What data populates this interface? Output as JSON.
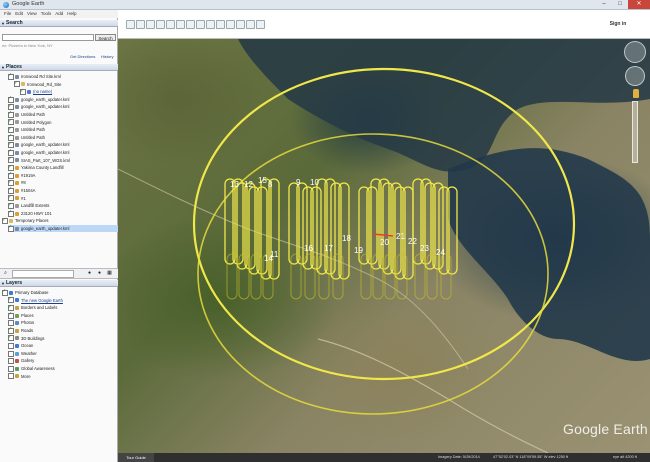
{
  "window": {
    "title": "Google Earth",
    "min": "–",
    "max": "□",
    "close": "✕"
  },
  "menu": [
    "File",
    "Edit",
    "View",
    "Tools",
    "Add",
    "Help"
  ],
  "toolbar": {
    "sign_in": "Sign in"
  },
  "search": {
    "header": "Search",
    "placeholder": "",
    "button": "Search",
    "hint": "ex: Pizzeria in New York, NY",
    "get_directions": "Get Directions",
    "history": "History"
  },
  "places": {
    "header": "Places",
    "items": [
      {
        "label": "Ironwood Rd Site.kml",
        "indent": 1,
        "checked": true,
        "icon": "kml-icon",
        "color": "#7a8aa0"
      },
      {
        "label": "Ironwood_Rd_Site",
        "indent": 2,
        "checked": true,
        "icon": "folder-icon",
        "color": "#d8b860"
      },
      {
        "label": "(no name)",
        "indent": 3,
        "checked": true,
        "icon": "path-icon",
        "color": "#5577cc",
        "link": true
      },
      {
        "label": "google_earth_updater.kml",
        "indent": 1,
        "checked": true,
        "icon": "kml-icon",
        "color": "#7a8aa0"
      },
      {
        "label": "google_earth_updater.kml",
        "indent": 1,
        "checked": true,
        "icon": "kml-icon",
        "color": "#7a8aa0"
      },
      {
        "label": "Untitled Path",
        "indent": 1,
        "checked": true,
        "icon": "path-icon",
        "color": "#9a9a9a"
      },
      {
        "label": "Untitled Polygon",
        "indent": 1,
        "checked": true,
        "icon": "polygon-icon",
        "color": "#9a9a9a"
      },
      {
        "label": "Untitled Path",
        "indent": 1,
        "checked": true,
        "icon": "path-icon",
        "color": "#9a9a9a"
      },
      {
        "label": "Untitled Path",
        "indent": 1,
        "checked": true,
        "icon": "path-icon",
        "color": "#9a9a9a"
      },
      {
        "label": "google_earth_updater.kml",
        "indent": 1,
        "checked": true,
        "icon": "kml-icon",
        "color": "#7a8aa0"
      },
      {
        "label": "google_earth_updater.kml",
        "indent": 1,
        "checked": true,
        "icon": "kml-icon",
        "color": "#7a8aa0"
      },
      {
        "label": "SIAS_Part_107_WGS.kml",
        "indent": 1,
        "checked": true,
        "icon": "kml-icon",
        "color": "#7a8aa0"
      },
      {
        "label": "Yakima County Landfill",
        "indent": 1,
        "checked": true,
        "icon": "placemark-icon",
        "color": "#d8a030"
      },
      {
        "label": "#1919A",
        "indent": 1,
        "checked": true,
        "icon": "placemark-icon",
        "color": "#d8a030"
      },
      {
        "label": "#8",
        "indent": 1,
        "checked": true,
        "icon": "placemark-icon",
        "color": "#d8a030"
      },
      {
        "label": "#1504A",
        "indent": 1,
        "checked": true,
        "icon": "placemark-icon",
        "color": "#d8a030"
      },
      {
        "label": "#1",
        "indent": 1,
        "checked": true,
        "icon": "placemark-icon",
        "color": "#d8a030"
      },
      {
        "label": "Landfill Extents",
        "indent": 1,
        "checked": true,
        "icon": "polygon-icon",
        "color": "#9a9a9a"
      },
      {
        "label": "23120 HWY 101",
        "indent": 1,
        "checked": true,
        "icon": "placemark-icon",
        "color": "#d8a030"
      },
      {
        "label": "Temporary Places",
        "indent": 0,
        "checked": true,
        "icon": "folder-icon",
        "color": "#d8b860"
      },
      {
        "label": "google_earth_updater.kml",
        "indent": 1,
        "checked": true,
        "icon": "kml-icon",
        "color": "#7a8aa0",
        "selected": true
      }
    ]
  },
  "layers": {
    "header": "Layers",
    "items": [
      {
        "label": "Primary Database",
        "indent": 0,
        "checked": true,
        "icon": "globe-icon",
        "color": "#3a7bd5"
      },
      {
        "label": "The new Google Earth",
        "indent": 1,
        "checked": true,
        "icon": "star-icon",
        "color": "#3a7bd5",
        "link": true
      },
      {
        "label": "Borders and Labels",
        "indent": 1,
        "checked": true,
        "icon": "borders-icon",
        "color": "#c8a040"
      },
      {
        "label": "Places",
        "indent": 1,
        "checked": true,
        "icon": "places-icon",
        "color": "#7a9a5a"
      },
      {
        "label": "Photos",
        "indent": 1,
        "checked": false,
        "icon": "photo-icon",
        "color": "#5a8ac0"
      },
      {
        "label": "Roads",
        "indent": 1,
        "checked": true,
        "icon": "road-icon",
        "color": "#c8a040"
      },
      {
        "label": "3D Buildings",
        "indent": 1,
        "checked": true,
        "icon": "building-icon",
        "color": "#8a8a8a"
      },
      {
        "label": "Ocean",
        "indent": 1,
        "checked": false,
        "icon": "ocean-icon",
        "color": "#3a7bd5"
      },
      {
        "label": "Weather",
        "indent": 1,
        "checked": false,
        "icon": "weather-icon",
        "color": "#5aa0d5"
      },
      {
        "label": "Gallery",
        "indent": 1,
        "checked": false,
        "icon": "gallery-icon",
        "color": "#c05050"
      },
      {
        "label": "Global Awareness",
        "indent": 1,
        "checked": false,
        "icon": "awareness-icon",
        "color": "#5a9a5a"
      },
      {
        "label": "More",
        "indent": 1,
        "checked": false,
        "icon": "more-icon",
        "color": "#c8a040"
      }
    ]
  },
  "map": {
    "labels": [
      "13",
      "12",
      "15",
      "8",
      "9",
      "10",
      "16",
      "17",
      "18",
      "19",
      "20",
      "21",
      "22",
      "23",
      "24",
      "14",
      "11"
    ],
    "watermark": "Google Earth",
    "route_color": "#f0e84a"
  },
  "statusbar": {
    "tour_guide": "Tour Guide",
    "imagery_date": "Imagery Date: 5/29/2014",
    "coords": "47°52'02.03\" N  118°09'59.55\" W  elev  1250 ft",
    "eye_alt": "eye alt  4200 ft"
  }
}
